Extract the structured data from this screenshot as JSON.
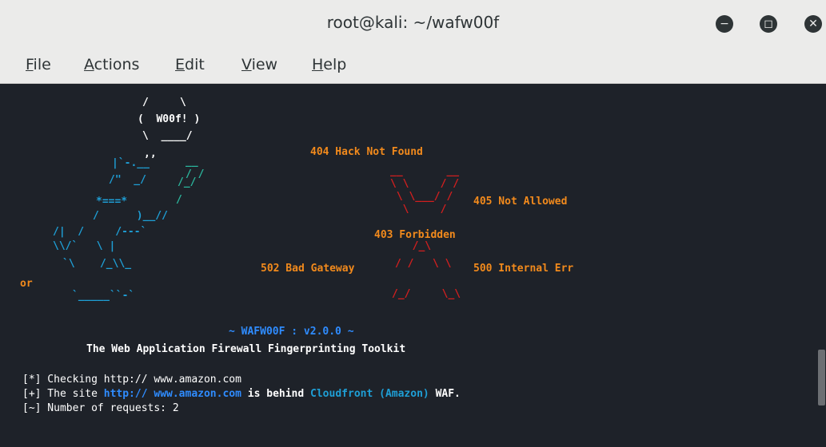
{
  "window": {
    "title": "root@kali: ~/wafw00f",
    "buttons": [
      "minimize",
      "maximize",
      "close"
    ]
  },
  "menu": [
    {
      "mnemonic": "F",
      "rest": "ile"
    },
    {
      "mnemonic": "A",
      "rest": "ctions"
    },
    {
      "mnemonic": "E",
      "rest": "dit"
    },
    {
      "mnemonic": "V",
      "rest": "iew"
    },
    {
      "mnemonic": "H",
      "rest": "elp"
    }
  ],
  "banner": {
    "speech": [
      "/     \\",
      "(  W00f! )",
      "\\  ____/"
    ],
    "label_404": "404 Hack Not Found",
    "label_405": "405 Not Allowed",
    "label_403": "403 Forbidden",
    "label_502": "502 Bad Gateway",
    "label_500": "500 Internal Err",
    "label_or": "or",
    "version": "~ WAFW00F : v2.0.0 ~",
    "tagline": "The Web Application Firewall Fingerprinting Toolkit"
  },
  "output": {
    "line1": {
      "prefix": "[*] Checking http:// www.amazon.com"
    },
    "line2": {
      "prefix": "[+] The site ",
      "url": "http:// www.amazon.com",
      "mid": " is behind ",
      "waf": "Cloudfront (Amazon)",
      "suffix": " WAF."
    },
    "line3": {
      "text": "[~] Number of requests: 2"
    }
  },
  "colors": {
    "terminal_bg": "#1e2229",
    "orange": "#f28a1c",
    "red": "#d21f1f",
    "cyan": "#1e9fd6",
    "green": "#2bb59c",
    "blue": "#2f8cff"
  }
}
